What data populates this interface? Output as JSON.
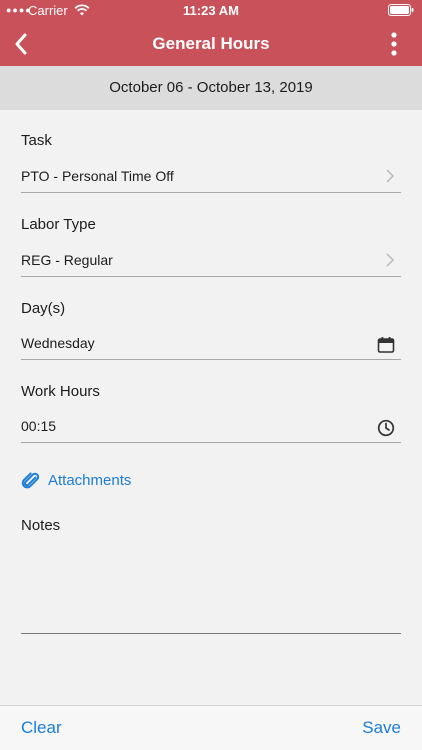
{
  "status_bar": {
    "carrier": "Carrier",
    "time": "11:23 AM"
  },
  "nav": {
    "title": "General Hours"
  },
  "date_range": "October 06 - October 13, 2019",
  "fields": {
    "task": {
      "label": "Task",
      "value": "PTO - Personal Time Off"
    },
    "labor_type": {
      "label": "Labor Type",
      "value": "REG - Regular"
    },
    "days": {
      "label": "Day(s)",
      "value": "Wednesday"
    },
    "work_hours": {
      "label": "Work Hours",
      "value": "00:15"
    }
  },
  "attachments_label": "Attachments",
  "notes_label": "Notes",
  "bottom_bar": {
    "clear_label": "Clear",
    "save_label": "Save"
  },
  "colors": {
    "header": "#c9515a",
    "accent": "#1d7dd6",
    "date_bar": "#dcdcdc",
    "background": "#f2f2f2"
  },
  "icons": [
    "wifi-icon",
    "battery-icon",
    "back-chevron-icon",
    "more-vertical-icon",
    "chevron-right-icon",
    "calendar-icon",
    "clock-icon",
    "paperclip-icon"
  ]
}
